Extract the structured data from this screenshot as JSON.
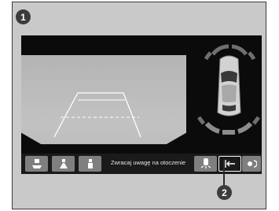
{
  "callouts": {
    "first": "1",
    "second": "2"
  },
  "bottom_bar": {
    "message": "Zwracaj uwagę na otoczenie",
    "buttons": [
      {
        "icon": "top-view-icon"
      },
      {
        "icon": "normal-view-icon"
      },
      {
        "icon": "side-view-icon"
      },
      {
        "icon": "parking-sensor-icon"
      },
      {
        "icon": "exit-view-icon"
      },
      {
        "icon": "brightness-icon"
      }
    ]
  },
  "colors": {
    "panel": "#c9c9c9",
    "screen": "#0b0b0b",
    "sensor_on": "#8c8c8c",
    "guide_lines": "#ffffff"
  }
}
